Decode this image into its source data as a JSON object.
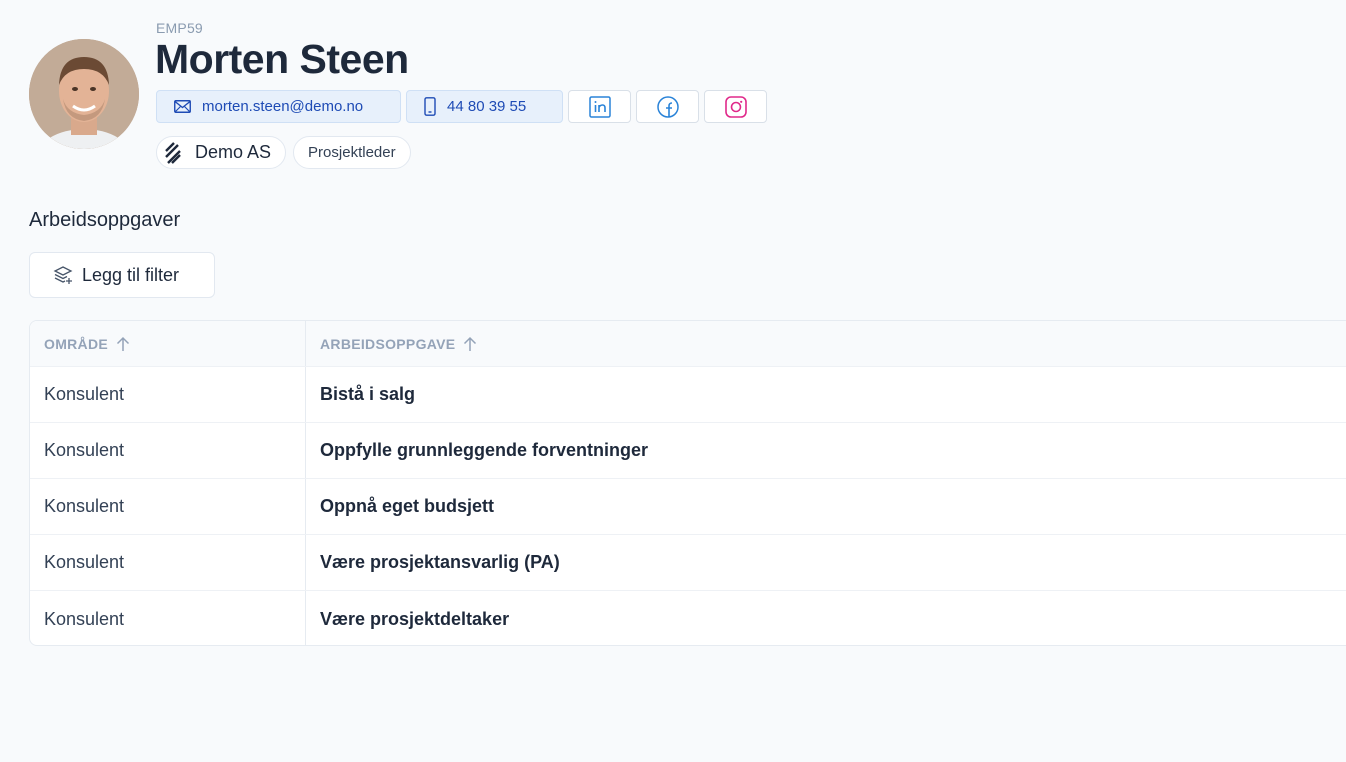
{
  "profile": {
    "employee_id": "EMP59",
    "name": "Morten Steen",
    "email": "morten.steen@demo.no",
    "phone": "44 80 39 55",
    "company": "Demo AS",
    "role": "Prosjektleder"
  },
  "social": {
    "linkedin_color": "#2a83d8",
    "facebook_color": "#2a83d8",
    "instagram_color": "#e0298a"
  },
  "section": {
    "title": "Arbeidsoppgaver",
    "filter_label": "Legg til filter"
  },
  "table": {
    "columns": [
      "OMRÅDE",
      "ARBEIDSOPPGAVE"
    ],
    "rows": [
      {
        "area": "Konsulent",
        "task": "Bistå i salg"
      },
      {
        "area": "Konsulent",
        "task": "Oppfylle grunnleggende forventninger"
      },
      {
        "area": "Konsulent",
        "task": "Oppnå eget budsjett"
      },
      {
        "area": "Konsulent",
        "task": "Være prosjektansvarlig (PA)"
      },
      {
        "area": "Konsulent",
        "task": "Være prosjektdeltaker"
      }
    ]
  }
}
